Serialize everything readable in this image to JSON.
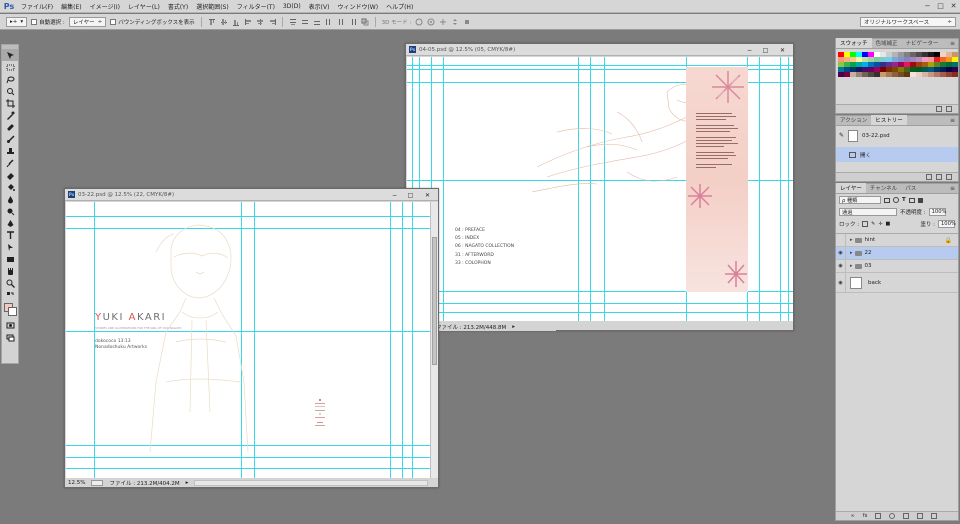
{
  "app": {
    "logo": "Ps",
    "menu": [
      "ファイル(F)",
      "編集(E)",
      "イメージ(I)",
      "レイヤー(L)",
      "書式(Y)",
      "選択範囲(S)",
      "フィルター(T)",
      "3D(D)",
      "表示(V)",
      "ウィンドウ(W)",
      "ヘルプ(H)"
    ],
    "window_controls": [
      "−",
      "□",
      "✕"
    ]
  },
  "options": {
    "move_tool": "▸+",
    "auto_select": "自動選択 :",
    "layer_select": "レイヤー",
    "bounding_box": "バウンディングボックスを表示",
    "mode_3d": "3D モード :",
    "workspace": "オリジナルワークスペース"
  },
  "doc_main": {
    "title": "03-22.psd @ 12.5% (22, CMYK/8#)",
    "cover_title_part1": "Y",
    "cover_title_part2": "UKI ",
    "cover_title_part3": "A",
    "cover_title_part4": "KARI",
    "cover_tiny": "STORIES AND ILLUSTRATIONS FOR THE GIRL OF YUKI NAGATO",
    "cover_line1": "dokococo 13:13",
    "cover_line2": "Nonadoshuku Artworks",
    "zoom": "12.5%",
    "file_info": "ファイル : 213.2M/404.2M"
  },
  "doc_second": {
    "title": "04-05.psd @ 12.5% (05, CMYK/8#)",
    "toc": [
      "04 : PREFACE",
      "05 : INDEX",
      "06 : NAGATO COLLECTION",
      "31 : AFTERWORD",
      "33 : COLOPHON"
    ],
    "file_info": "ファイル : 213.2M/448.8M"
  },
  "panels": {
    "swatch_tabs": [
      "スウォッチ",
      "色域補正",
      "ナビゲーター"
    ],
    "history_tabs": [
      "アクション",
      "ヒストリー"
    ],
    "history_items": [
      "03-22.psd",
      "開く"
    ],
    "layer_tabs": [
      "レイヤー",
      "チャンネル",
      "パス"
    ],
    "kind_filter": "ρ 種類",
    "blend_mode": "通過",
    "opacity_label": "不透明度 :",
    "opacity_value": "100%",
    "lock_label": "ロック :",
    "fill_label": "塗り :",
    "fill_value": "100%",
    "layers": [
      {
        "name": "hint",
        "type": "folder",
        "visible": false,
        "locked": true,
        "selected": false
      },
      {
        "name": "22",
        "type": "folder",
        "visible": true,
        "locked": false,
        "selected": true
      },
      {
        "name": "03",
        "type": "folder",
        "visible": true,
        "locked": false,
        "selected": false
      },
      {
        "name": "back",
        "type": "layer",
        "visible": true,
        "locked": false,
        "selected": false
      }
    ]
  },
  "colors": {
    "guide": "#38d8ea",
    "foreground": "#f3c9c0",
    "selection": "#b6cbef",
    "accent": "#d9554f"
  }
}
